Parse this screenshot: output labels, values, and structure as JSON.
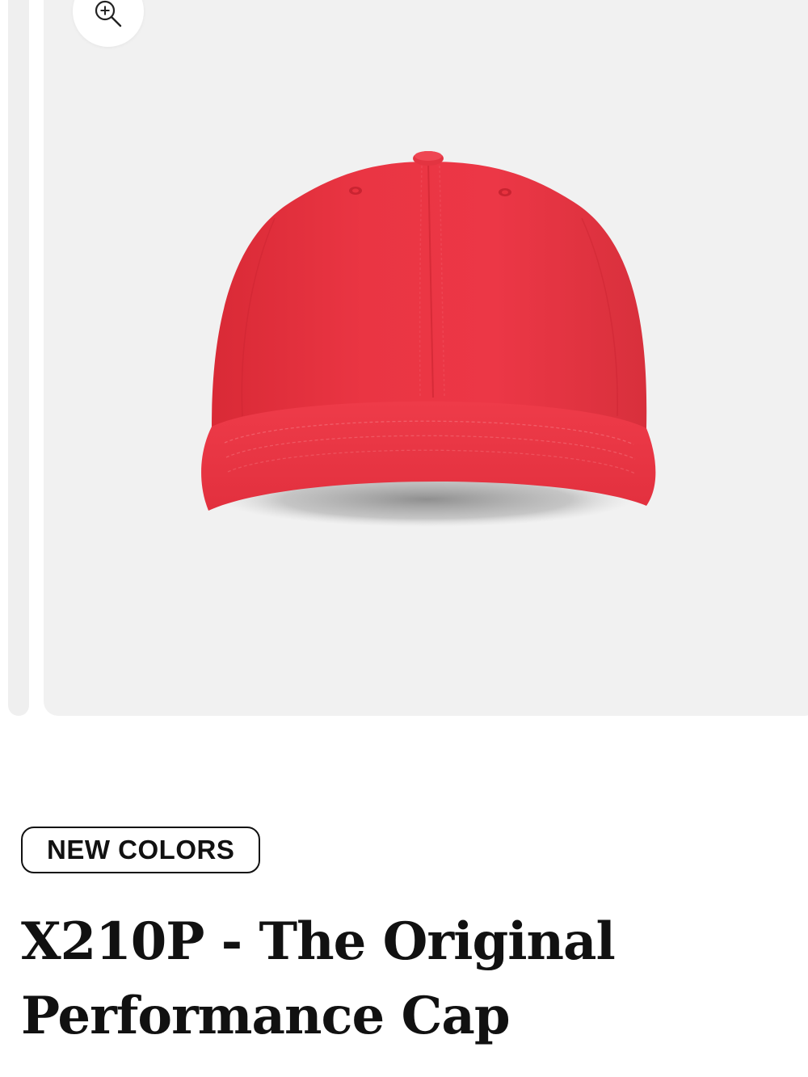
{
  "gallery": {
    "zoom_icon": "zoom-in-icon",
    "product_image": "red-baseball-cap",
    "cap_color": "#e8323f",
    "background_color": "#f1f1f1"
  },
  "product": {
    "badge": "NEW COLORS",
    "title": "X210P - The Original Performance Cap"
  }
}
